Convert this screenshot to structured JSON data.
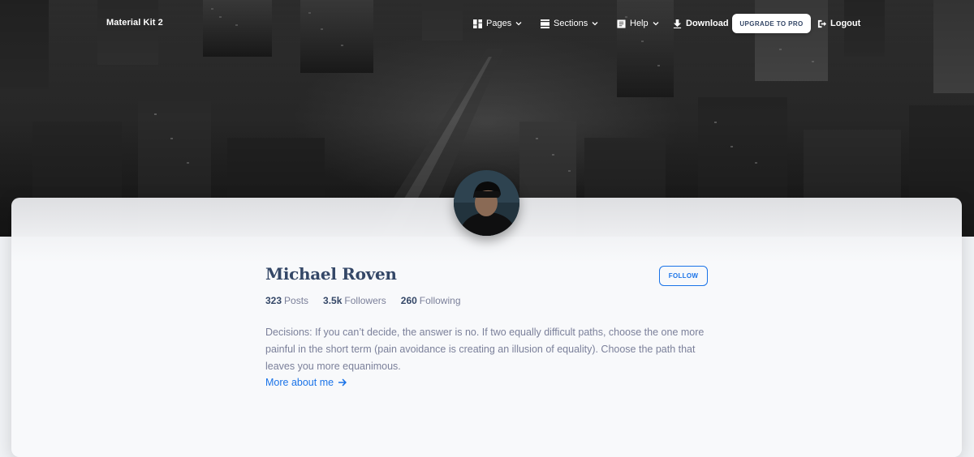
{
  "navbar": {
    "brand": "Material Kit 2",
    "items": [
      {
        "label": "Pages",
        "icon": "dashboard-icon",
        "dropdown": true
      },
      {
        "label": "Sections",
        "icon": "view-day-icon",
        "dropdown": true
      },
      {
        "label": "Help",
        "icon": "article-icon",
        "dropdown": true
      },
      {
        "label": "Download",
        "icon": "download-icon",
        "dropdown": false
      }
    ],
    "upgrade_label": "UPGRADE TO PRO",
    "logout_label": "Logout"
  },
  "profile": {
    "name": "Michael Roven",
    "follow_label": "FOLLOW",
    "stats": [
      {
        "value": "323",
        "label": "Posts"
      },
      {
        "value": "3.5k",
        "label": "Followers"
      },
      {
        "value": "260",
        "label": "Following"
      }
    ],
    "bio": "Decisions: If you can’t decide, the answer is no. If two equally difficult paths, choose the one more painful in the short term (pain avoidance is creating an illusion of equality). Choose the path that leaves you more equanimous.",
    "more_link": "More about me"
  },
  "colors": {
    "accent": "#1a73e8",
    "heading": "#344767",
    "body_text": "#7b809a"
  }
}
